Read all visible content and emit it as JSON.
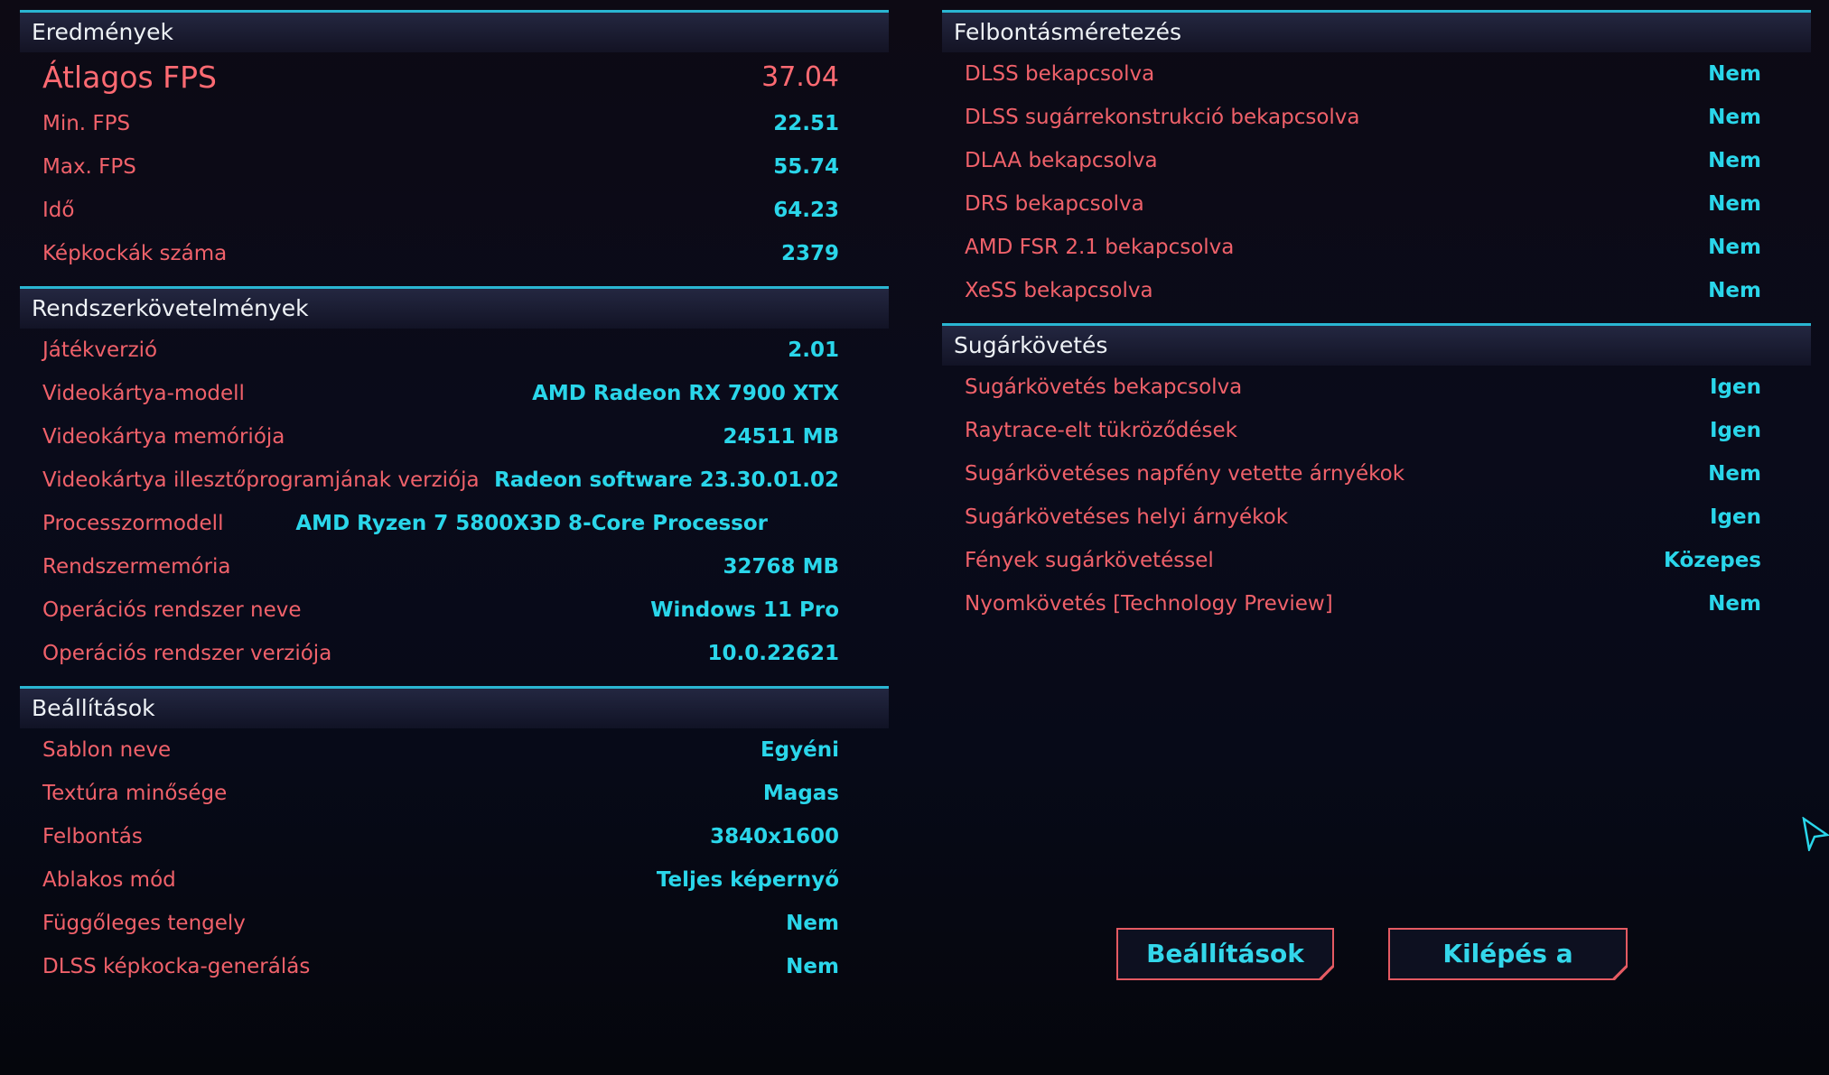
{
  "left": {
    "results": {
      "title": "Eredmények",
      "avg_label": "Átlagos FPS",
      "avg_value": "37.04",
      "rows": [
        {
          "label": "Min. FPS",
          "value": "22.51"
        },
        {
          "label": "Max. FPS",
          "value": "55.74"
        },
        {
          "label": "Idő",
          "value": "64.23"
        },
        {
          "label": "Képkockák száma",
          "value": "2379"
        }
      ]
    },
    "system": {
      "title": "Rendszerkövetelmények",
      "rows": [
        {
          "label": "Játékverzió",
          "value": "2.01"
        },
        {
          "label": "Videokártya-modell",
          "value": "AMD Radeon RX 7900 XTX"
        },
        {
          "label": "Videokártya memóriója",
          "value": "24511 MB"
        },
        {
          "label": "Videokártya illesztőprogramjának verziója",
          "value": "Radeon software 23.30.01.02"
        },
        {
          "label": "Processzormodell",
          "value": "AMD Ryzen 7 5800X3D 8-Core Processor"
        },
        {
          "label": "Rendszermemória",
          "value": "32768 MB"
        },
        {
          "label": "Operációs rendszer neve",
          "value": "Windows 11 Pro"
        },
        {
          "label": "Operációs rendszer verziója",
          "value": "10.0.22621"
        }
      ]
    },
    "settings": {
      "title": "Beállítások",
      "rows": [
        {
          "label": "Sablon neve",
          "value": "Egyéni"
        },
        {
          "label": "Textúra minősége",
          "value": "Magas"
        },
        {
          "label": "Felbontás",
          "value": "3840x1600"
        },
        {
          "label": "Ablakos mód",
          "value": "Teljes képernyő"
        },
        {
          "label": "Függőleges tengely",
          "value": "Nem"
        },
        {
          "label": "DLSS képkocka-generálás",
          "value": "Nem"
        }
      ]
    }
  },
  "right": {
    "scaling": {
      "title": "Felbontásméretezés",
      "rows": [
        {
          "label": "DLSS bekapcsolva",
          "value": "Nem"
        },
        {
          "label": "DLSS sugárrekonstrukció bekapcsolva",
          "value": "Nem"
        },
        {
          "label": "DLAA bekapcsolva",
          "value": "Nem"
        },
        {
          "label": "DRS bekapcsolva",
          "value": "Nem"
        },
        {
          "label": "AMD FSR 2.1 bekapcsolva",
          "value": "Nem"
        },
        {
          "label": "XeSS bekapcsolva",
          "value": "Nem"
        }
      ]
    },
    "raytracing": {
      "title": "Sugárkövetés",
      "rows": [
        {
          "label": "Sugárkövetés bekapcsolva",
          "value": "Igen"
        },
        {
          "label": "Raytrace-elt tükröződések",
          "value": "Igen"
        },
        {
          "label": "Sugárkövetéses napfény vetette árnyékok",
          "value": "Nem"
        },
        {
          "label": "Sugárkövetéses helyi árnyékok",
          "value": "Igen"
        },
        {
          "label": "Fények sugárkövetéssel",
          "value": "Közepes"
        },
        {
          "label": "Nyomkövetés [Technology Preview]",
          "value": "Nem"
        }
      ]
    }
  },
  "buttons": {
    "settings": "Beállítások",
    "exit": "Kilépés a főmenübe"
  },
  "colors": {
    "accent_cyan": "#2ad6ea",
    "label_red": "#f0616a",
    "header_line": "#2ab6d2"
  }
}
